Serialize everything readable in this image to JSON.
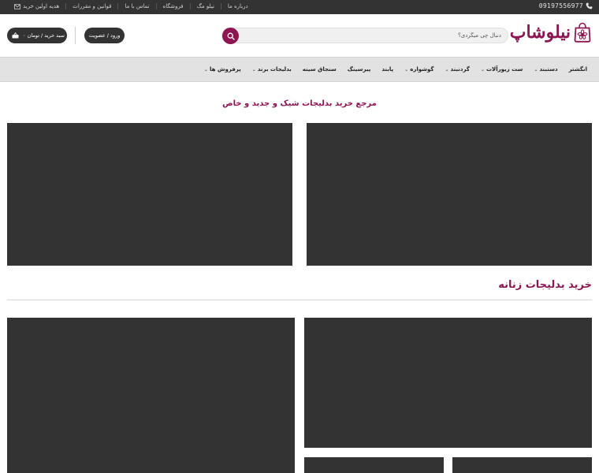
{
  "topbar": {
    "phone": "09197556977",
    "links": [
      {
        "label": "درباره ما",
        "name": "topbar-link-about"
      },
      {
        "label": "نیلو مگ",
        "name": "topbar-link-mag"
      },
      {
        "label": "فروشگاه",
        "name": "topbar-link-shop"
      },
      {
        "label": "تماس با ما",
        "name": "topbar-link-contact"
      },
      {
        "label": "قوانین و مقررات",
        "name": "topbar-link-rules"
      }
    ],
    "gift_label": "هدیه اولین خرید"
  },
  "header": {
    "logo_text": "نیلوشاپ",
    "search_placeholder": "دنبال چی میگردی؟",
    "login_label": "ورود / عضویت",
    "cart_label": "سبد خرید / تومان ۰"
  },
  "nav": {
    "items": [
      {
        "label": "انگشتر",
        "has_menu": false
      },
      {
        "label": "دستبند",
        "has_menu": true
      },
      {
        "label": "ست زیورآلات",
        "has_menu": true
      },
      {
        "label": "گردنبند",
        "has_menu": true
      },
      {
        "label": "گوشواره",
        "has_menu": true
      },
      {
        "label": "پابند",
        "has_menu": false
      },
      {
        "label": "پیرسینگ",
        "has_menu": false
      },
      {
        "label": "سنجاق سینه",
        "has_menu": false
      },
      {
        "label": "بدلیجات برند",
        "has_menu": true
      },
      {
        "label": "پرفروش ها",
        "has_menu": true
      }
    ]
  },
  "main": {
    "tagline": "مرجع خرید بدلیجات شیک و جدید و خاص",
    "section_title": "خرید بدلیجات زنانه"
  },
  "colors": {
    "brand": "#8c1552",
    "dark": "#333333",
    "nav_bg": "#e2e2e2"
  }
}
